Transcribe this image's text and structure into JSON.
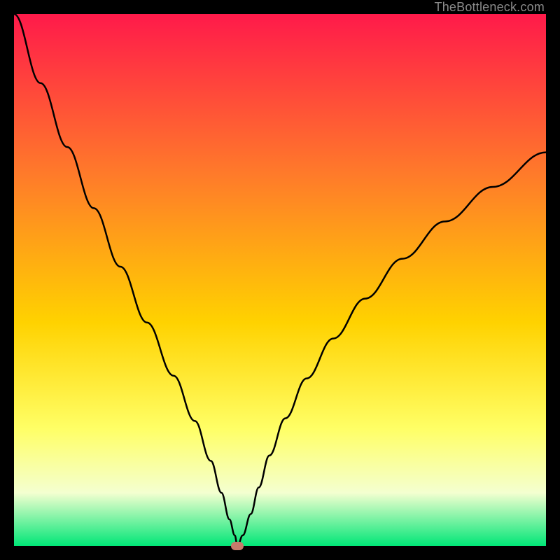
{
  "watermark": "TheBottleneck.com",
  "colors": {
    "top": "#ff1a4a",
    "mid_upper": "#ff7a2a",
    "mid": "#ffd200",
    "mid_lower": "#ffff66",
    "pale": "#f4ffd0",
    "bottom": "#00e677",
    "curve": "#000000",
    "marker": "#c77a6b",
    "frame": "#000000"
  },
  "chart_data": {
    "type": "line",
    "title": "",
    "xlabel": "",
    "ylabel": "",
    "xlim": [
      0,
      100
    ],
    "ylim": [
      0,
      100
    ],
    "series": [
      {
        "name": "bottleneck-curve",
        "x": [
          0,
          5,
          10,
          15,
          20,
          25,
          30,
          34,
          37,
          39,
          40.5,
          41.5,
          42,
          43,
          44.5,
          46,
          48,
          51,
          55,
          60,
          66,
          73,
          81,
          90,
          100
        ],
        "y": [
          100,
          87,
          75,
          63.5,
          52.5,
          42,
          32,
          23.5,
          16,
          10,
          5,
          2,
          0,
          2,
          6,
          11,
          17,
          24,
          31.5,
          39,
          46.5,
          54,
          61,
          67.5,
          74
        ]
      }
    ],
    "marker": {
      "x": 42,
      "y": 0
    },
    "gradient_stops": [
      {
        "pct": 0,
        "color": "#ff1a4a"
      },
      {
        "pct": 30,
        "color": "#ff7a2a"
      },
      {
        "pct": 58,
        "color": "#ffd200"
      },
      {
        "pct": 78,
        "color": "#ffff66"
      },
      {
        "pct": 90,
        "color": "#f4ffd0"
      },
      {
        "pct": 100,
        "color": "#00e677"
      }
    ]
  }
}
